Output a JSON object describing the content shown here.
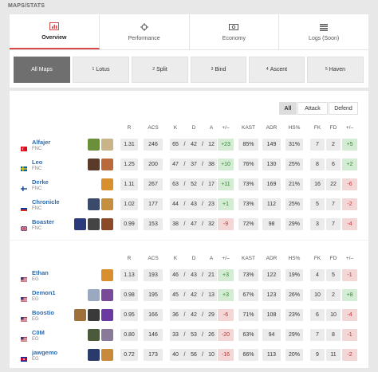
{
  "section_label": "MAPS/STATS",
  "tabs": [
    {
      "label": "Overview",
      "icon": "bar-chart-icon",
      "active": true
    },
    {
      "label": "Performance",
      "icon": "crosshair-icon",
      "active": false
    },
    {
      "label": "Economy",
      "icon": "money-icon",
      "active": false
    },
    {
      "label": "Logs (Soon)",
      "icon": "list-icon",
      "active": false
    }
  ],
  "maps": [
    {
      "num": "",
      "name": "All Maps",
      "active": true
    },
    {
      "num": "1",
      "name": "Lotus",
      "active": false
    },
    {
      "num": "2",
      "name": "Split",
      "active": false
    },
    {
      "num": "3",
      "name": "Bind",
      "active": false
    },
    {
      "num": "4",
      "name": "Ascent",
      "active": false
    },
    {
      "num": "5",
      "name": "Haven",
      "active": false
    }
  ],
  "filters": [
    {
      "label": "All",
      "active": true
    },
    {
      "label": "Attack",
      "active": false
    },
    {
      "label": "Defend",
      "active": false
    }
  ],
  "columns": {
    "r": "R",
    "acs": "ACS",
    "k": "K",
    "d": "D",
    "a": "A",
    "diff": "+/–",
    "kast": "KAST",
    "adr": "ADR",
    "hs": "HS%",
    "fk": "FK",
    "fd": "FD",
    "fkdiff": "+/–"
  },
  "colors": {
    "accent": "#d84a4a",
    "link": "#2c6cb2",
    "positive": "#2e8a2e",
    "negative": "#c03434"
  },
  "teams": [
    {
      "players": [
        {
          "name": "Alfajer",
          "team": "FNC",
          "flag": "turkey",
          "agents": [
            "agent-a",
            "agent-b"
          ],
          "r": "1.31",
          "acs": "246",
          "k": "65",
          "d": "42",
          "a": "12",
          "diff": "+23",
          "kast": "85%",
          "adr": "149",
          "hs": "31%",
          "fk": "7",
          "fd": "2",
          "fkdiff": "+5"
        },
        {
          "name": "Leo",
          "team": "FNC",
          "flag": "sweden",
          "agents": [
            "agent-c",
            "agent-d"
          ],
          "r": "1.25",
          "acs": "200",
          "k": "47",
          "d": "37",
          "a": "38",
          "diff": "+10",
          "kast": "76%",
          "adr": "130",
          "hs": "25%",
          "fk": "8",
          "fd": "6",
          "fkdiff": "+2"
        },
        {
          "name": "Derke",
          "team": "FNC",
          "flag": "finland",
          "agents": [
            "agent-e"
          ],
          "r": "1.11",
          "acs": "267",
          "k": "63",
          "d": "52",
          "a": "17",
          "diff": "+11",
          "kast": "73%",
          "adr": "169",
          "hs": "21%",
          "fk": "16",
          "fd": "22",
          "fkdiff": "-6"
        },
        {
          "name": "Chronicle",
          "team": "FNC",
          "flag": "russia",
          "agents": [
            "agent-f",
            "agent-g"
          ],
          "r": "1.02",
          "acs": "177",
          "k": "44",
          "d": "43",
          "a": "23",
          "diff": "+1",
          "kast": "73%",
          "adr": "112",
          "hs": "25%",
          "fk": "5",
          "fd": "7",
          "fkdiff": "-2"
        },
        {
          "name": "Boaster",
          "team": "FNC",
          "flag": "uk",
          "agents": [
            "agent-h",
            "agent-i",
            "agent-j"
          ],
          "r": "0.99",
          "acs": "153",
          "k": "38",
          "d": "47",
          "a": "32",
          "diff": "-9",
          "kast": "72%",
          "adr": "98",
          "hs": "29%",
          "fk": "3",
          "fd": "7",
          "fkdiff": "-4"
        }
      ]
    },
    {
      "players": [
        {
          "name": "Ethan",
          "team": "EG",
          "flag": "usa",
          "agents": [
            "agent-e"
          ],
          "r": "1.13",
          "acs": "193",
          "k": "46",
          "d": "43",
          "a": "21",
          "diff": "+3",
          "kast": "73%",
          "adr": "122",
          "hs": "19%",
          "fk": "4",
          "fd": "5",
          "fkdiff": "-1"
        },
        {
          "name": "Demon1",
          "team": "EG",
          "flag": "usa",
          "agents": [
            "agent-k",
            "agent-l"
          ],
          "r": "0.98",
          "acs": "195",
          "k": "45",
          "d": "42",
          "a": "13",
          "diff": "+3",
          "kast": "67%",
          "adr": "123",
          "hs": "26%",
          "fk": "10",
          "fd": "2",
          "fkdiff": "+8"
        },
        {
          "name": "Boostio",
          "team": "EG",
          "flag": "usa",
          "agents": [
            "agent-m",
            "agent-n",
            "agent-o"
          ],
          "r": "0.95",
          "acs": "166",
          "k": "36",
          "d": "42",
          "a": "29",
          "diff": "-6",
          "kast": "71%",
          "adr": "108",
          "hs": "23%",
          "fk": "6",
          "fd": "10",
          "fkdiff": "-4"
        },
        {
          "name": "C0M",
          "team": "EG",
          "flag": "usa",
          "agents": [
            "agent-p",
            "agent-q"
          ],
          "r": "0.80",
          "acs": "146",
          "k": "33",
          "d": "53",
          "a": "26",
          "diff": "-20",
          "kast": "63%",
          "adr": "94",
          "hs": "29%",
          "fk": "7",
          "fd": "8",
          "fkdiff": "-1"
        },
        {
          "name": "jawgemo",
          "team": "EG",
          "flag": "cambodia",
          "agents": [
            "agent-r",
            "agent-s"
          ],
          "r": "0.72",
          "acs": "173",
          "k": "40",
          "d": "56",
          "a": "10",
          "diff": "-16",
          "kast": "66%",
          "adr": "113",
          "hs": "20%",
          "fk": "9",
          "fd": "11",
          "fkdiff": "-2"
        }
      ]
    }
  ]
}
